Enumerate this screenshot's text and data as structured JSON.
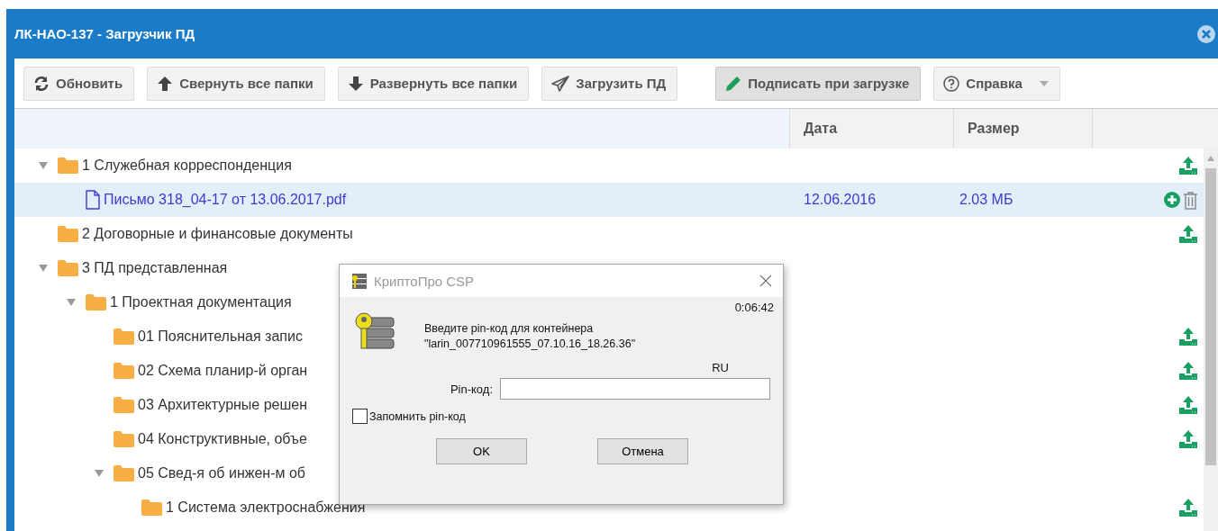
{
  "window": {
    "title": "ЛК-НАО-137 - Загрузчик ПД"
  },
  "toolbar": [
    {
      "kind": "refresh",
      "label": "Обновить",
      "pressed": false,
      "dropdown": false
    },
    {
      "kind": "up",
      "label": "Свернуть все папки",
      "pressed": false,
      "dropdown": false
    },
    {
      "kind": "down",
      "label": "Развернуть все папки",
      "pressed": false,
      "dropdown": false
    },
    {
      "kind": "send",
      "label": "Загрузить ПД",
      "pressed": false,
      "dropdown": false
    },
    {
      "kind": "pencil",
      "label": "Подписать при загрузке",
      "pressed": true,
      "dropdown": false
    },
    {
      "kind": "help",
      "label": "Справка",
      "pressed": false,
      "dropdown": true
    }
  ],
  "table": {
    "columns": [
      {
        "label": "Дата"
      },
      {
        "label": "Размер"
      }
    ],
    "rows": [
      {
        "kind": "folder",
        "name": "1 Служебная корреспонденция",
        "expanded": true,
        "selected": false,
        "upload": true,
        "children": [
          {
            "kind": "file",
            "name": "Письмо 318_04-17 от 13.06.2017.pdf",
            "date": "12.06.2016",
            "size": "2.03 МБ",
            "selected": true,
            "add": true,
            "delete": true
          }
        ]
      },
      {
        "kind": "folder",
        "name": "2 Договорные и финансовые документы",
        "selected": false,
        "upload": true
      },
      {
        "kind": "folder",
        "name": "3 ПД представленная",
        "expanded": true,
        "selected": false,
        "children": [
          {
            "kind": "folder",
            "name": "1 Проектная документация",
            "expanded": true,
            "selected": false,
            "children": [
              {
                "kind": "folder",
                "name": "01 Пояснительная запис",
                "selected": false,
                "upload": true
              },
              {
                "kind": "folder",
                "name": "02 Схема планир-й орган",
                "selected": false,
                "upload": true
              },
              {
                "kind": "folder",
                "name": "03 Архитектурные решен",
                "selected": false,
                "upload": true
              },
              {
                "kind": "folder",
                "name": "04 Конструктивные, объе",
                "selected": false,
                "upload": true
              },
              {
                "kind": "folder",
                "name": "05 Свед-я об инжен-м об",
                "expanded": true,
                "selected": false,
                "children": [
                  {
                    "kind": "folder",
                    "name": "1 Система электроснабжения",
                    "selected": false,
                    "upload": true
                  }
                ]
              }
            ]
          }
        ]
      }
    ]
  },
  "dialog": {
    "title": "КриптоПро CSP",
    "timer": "0:06:42",
    "message": "Введите pin-код для контейнера\n\"larin_007710961555_07.10.16_18.26.36\"",
    "language": "RU",
    "field": {
      "label": "Pin-код:"
    },
    "remember": {
      "label": "Запомнить pin-код",
      "checked": false
    },
    "buttons": [
      "OK",
      "Отмена"
    ]
  }
}
